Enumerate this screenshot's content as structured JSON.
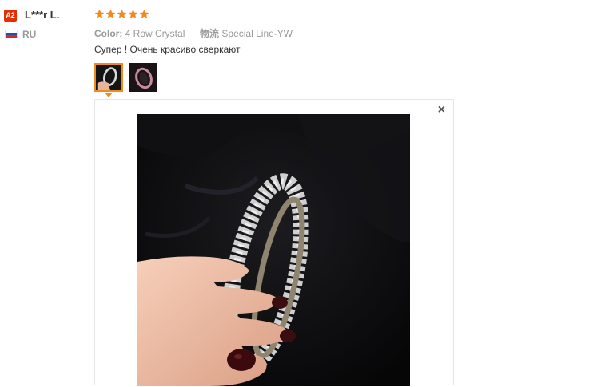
{
  "reviewer": {
    "badge": "A2",
    "name": "L***r L.",
    "country": "RU",
    "flag_colors": [
      "#ffffff",
      "#1f4fb4",
      "#d52b1e"
    ]
  },
  "rating": {
    "stars": 5,
    "max": 5,
    "color": "#f08a1d"
  },
  "order_info": {
    "color_label": "Color:",
    "color_value": "4 Row Crystal",
    "shipping_label": "物流",
    "shipping_value": "Special Line-YW"
  },
  "review": {
    "text": "Супер ! Очень красиво сверкают"
  },
  "photos": {
    "thumbnails": [
      {
        "name": "photo-1",
        "selected": true
      },
      {
        "name": "photo-2",
        "selected": false
      }
    ],
    "viewer": {
      "close_label": "×"
    }
  },
  "colors": {
    "accent": "#f08a1d",
    "badge": "#e62e04"
  }
}
